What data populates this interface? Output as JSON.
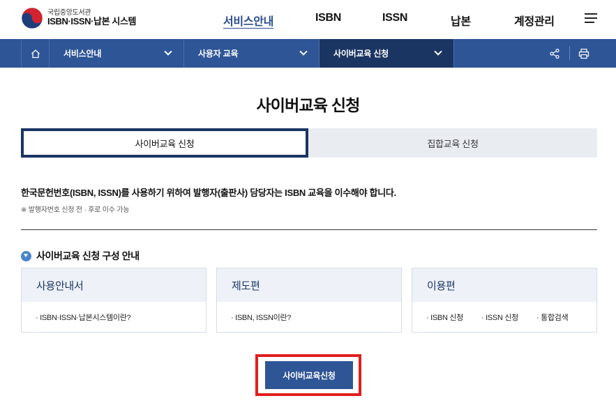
{
  "header": {
    "logo_sub": "국립중앙도서관",
    "logo_main": "ISBN·ISSN·납본 시스템",
    "nav": [
      {
        "label": "서비스안내",
        "active": true
      },
      {
        "label": "ISBN",
        "active": false
      },
      {
        "label": "ISSN",
        "active": false
      },
      {
        "label": "납본",
        "active": false
      },
      {
        "label": "계정관리",
        "active": false
      }
    ],
    "menu_icon": "hamburger-icon"
  },
  "location": {
    "home_icon": "home-icon",
    "items": [
      {
        "label": "서비스안내"
      },
      {
        "label": "사용자 교육"
      },
      {
        "label": "사이버교육 신청"
      }
    ],
    "tools": [
      "share-icon",
      "print-icon"
    ]
  },
  "page": {
    "title": "사이버교육 신청",
    "tabs": [
      {
        "label": "사이버교육 신청",
        "active": true
      },
      {
        "label": "집합교육 신청",
        "active": false
      }
    ],
    "intro": "한국문헌번호(ISBN, ISSN)를 사용하기 위하여 발행자(출판사) 담당자는 ISBN 교육을 이수해야 합니다.",
    "note": "※ 발행자번호 신청 전 · 후로 이수 가능",
    "section_title": "사이버교육 신청 구성 안내",
    "cards": [
      {
        "title": "사용안내서",
        "items": [
          "ISBN·ISSN·납본시스템이란?"
        ]
      },
      {
        "title": "제도편",
        "items": [
          "ISBN, ISSN이란?"
        ]
      },
      {
        "title": "이용편",
        "items": [
          "ISBN 신청",
          "ISSN 신청",
          "통합검색"
        ]
      }
    ],
    "apply_button": "사이버교육신청"
  },
  "colors": {
    "primary": "#2e5596",
    "primary_dark": "#1b3563",
    "highlight": "#e01e1e",
    "tab_inactive_bg": "#e9edf2",
    "card_head_bg": "#eef2f8"
  }
}
